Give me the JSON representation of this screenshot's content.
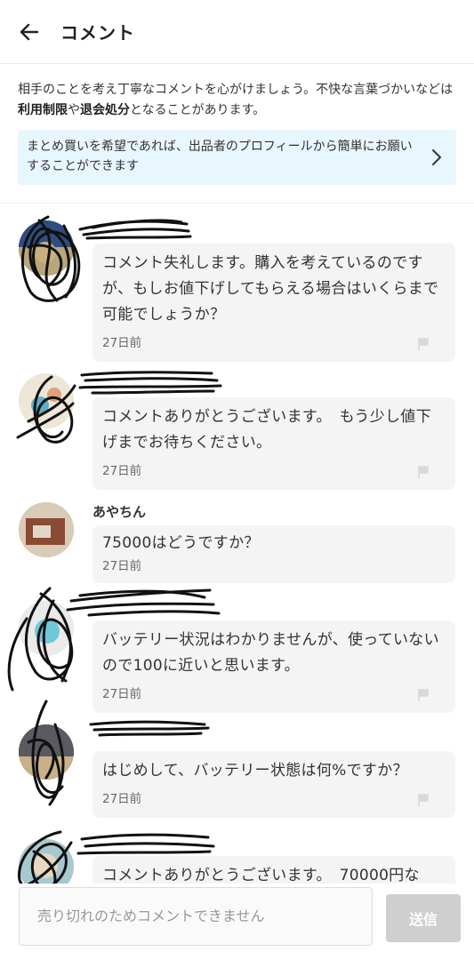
{
  "header": {
    "title": "コメント",
    "back_icon": "arrow-left-icon"
  },
  "notice": {
    "part1": "相手のことを考え丁寧なコメントを心がけましょう。不快な言葉づかいなどは",
    "term1": "利用制限",
    "part2": "や",
    "term2": "退会処分",
    "part3": "となることがあります。"
  },
  "info_banner": {
    "text": "まとめ買いを希望であれば、出品者のプロフィールから簡単にお願いすることができます",
    "icon": "chevron-right-icon",
    "background": "#e8f6fd"
  },
  "comments": [
    {
      "username": "",
      "text": "コメント失礼します。購入を考えているのですが、もしお値下げしてもらえる場合はいくらまで可能でしょうか？",
      "time": "27日前",
      "flag_icon": "flag-icon"
    },
    {
      "username": "",
      "text": "コメントありがとうございます。　もう少し値下げまでお待ちください。",
      "time": "27日前",
      "flag_icon": "flag-icon"
    },
    {
      "username": "あやちん",
      "text": "75000はどうですか？",
      "time": "27日前"
    },
    {
      "username": "",
      "text": "バッテリー状況はわかりませんが、使っていないので100に近いと思います。",
      "time": "27日前",
      "flag_icon": "flag-icon"
    },
    {
      "username": "",
      "text": "はじめして、バッテリー状態は何%ですか？",
      "time": "27日前",
      "flag_icon": "flag-icon"
    },
    {
      "username": "",
      "text": "コメントありがとうございます。　70000円な",
      "time": ""
    }
  ],
  "footer": {
    "input_placeholder": "売り切れのためコメントできません",
    "send_label": "送信"
  }
}
